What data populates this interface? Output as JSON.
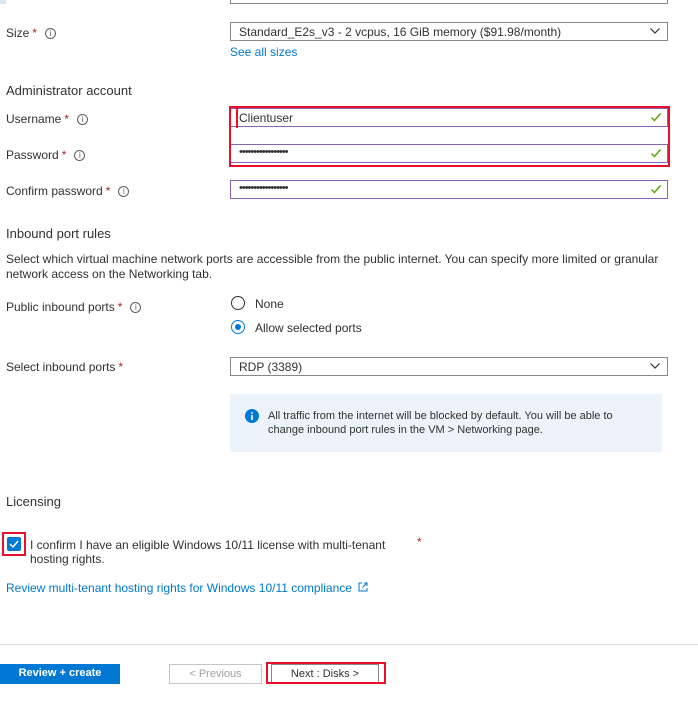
{
  "size": {
    "label": "Size",
    "value": "Standard_E2s_v3 - 2 vcpus, 16 GiB memory ($91.98/month)",
    "see_all": "See all sizes"
  },
  "admin": {
    "heading": "Administrator account",
    "username_label": "Username",
    "username_value": "Clientuser",
    "password_label": "Password",
    "password_value": "•••••••••••••••••",
    "confirm_label": "Confirm password",
    "confirm_value": "•••••••••••••••••"
  },
  "inbound": {
    "heading": "Inbound port rules",
    "description_line1": "Select which virtual machine network ports are accessible from the public internet. You can specify more limited or granular",
    "description_line2": "network access on the Networking tab.",
    "public_label": "Public inbound ports",
    "option_none": "None",
    "option_allow": "Allow selected ports",
    "select_label": "Select inbound ports",
    "select_value": "RDP (3389)",
    "info_line1": "All traffic from the internet will be blocked by default. You will be able to",
    "info_line2": "change inbound port rules in the VM > Networking page."
  },
  "licensing": {
    "heading": "Licensing",
    "confirm_line1": "I confirm I have an eligible Windows 10/11 license with multi-tenant",
    "confirm_line2": "hosting rights.",
    "required_mark": "*",
    "link": "Review multi-tenant hosting rights for Windows 10/11 compliance"
  },
  "footer": {
    "review_create": "Review + create",
    "previous": "< Previous",
    "next": "Next : Disks >"
  },
  "colors": {
    "accent": "#0078d4",
    "highlight": "#e8102a",
    "valid_green": "#57a300"
  },
  "icons": [
    "info-icon",
    "chevron-down-icon",
    "checkmark-icon",
    "external-link-icon"
  ]
}
